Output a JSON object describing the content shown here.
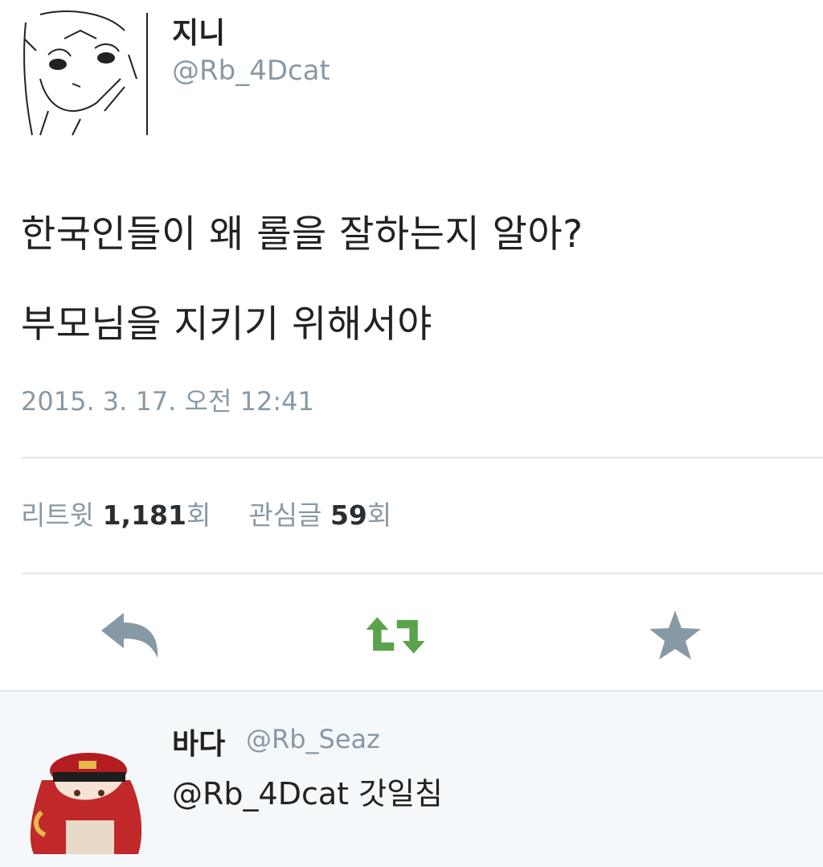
{
  "tweet": {
    "author_name": "지니",
    "author_handle": "@Rb_4Dcat",
    "text_line1": "한국인들이 왜 롤을 잘하는지 알아?",
    "text_line2": "부모님을 지키기 위해서야",
    "timestamp": "2015. 3. 17. 오전 12:41",
    "stats": {
      "retweet_label": "리트윗",
      "retweet_count": "1,181",
      "retweet_unit": "회",
      "favorite_label": "관심글",
      "favorite_count": "59",
      "favorite_unit": "회"
    },
    "actions": {
      "reply_icon": "reply-icon",
      "retweet_icon": "retweet-icon",
      "favorite_icon": "star-icon",
      "retweet_color": "#5aa34a",
      "icon_color": "#8899a6"
    }
  },
  "reply": {
    "author_name": "바다",
    "author_handle": "@Rb_Seaz",
    "text": "@Rb_4Dcat 갓일침"
  }
}
